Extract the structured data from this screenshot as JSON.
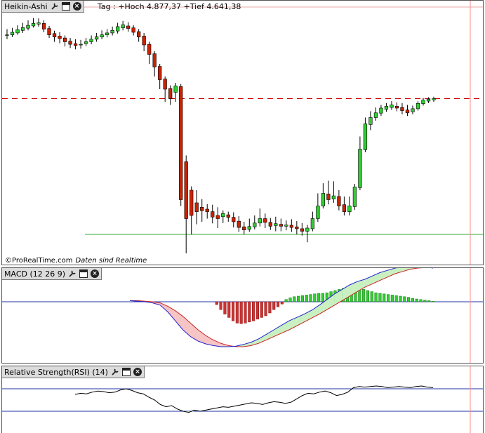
{
  "main": {
    "title": "Heikin-Ashi",
    "info": "Tag : +Hoch 4.877,37 +Tief 4.641,38",
    "copyright": "©ProRealTime.com",
    "realtime": "Daten sind Realtime"
  },
  "macd": {
    "title": "MACD (12 26 9)"
  },
  "rsi": {
    "title": "Relative Strength(RSI) (14)"
  },
  "colors": {
    "up": "#33cc33",
    "down": "#cc2200",
    "wick": "#000000",
    "resistance": "#cc0000",
    "support": "#33aa33",
    "macd_line": "#2222cc",
    "signal_line": "#cc2222",
    "cursor": "#ff8888"
  },
  "chart_data": [
    {
      "type": "candlestick",
      "name": "Heikin-Ashi",
      "ohlc": [
        [
          4820,
          4822,
          4808,
          4840
        ],
        [
          4822,
          4830,
          4815,
          4844
        ],
        [
          4828,
          4838,
          4822,
          4852
        ],
        [
          4836,
          4845,
          4828,
          4860
        ],
        [
          4843,
          4852,
          4836,
          4868
        ],
        [
          4850,
          4858,
          4845,
          4875
        ],
        [
          4856,
          4860,
          4848,
          4874
        ],
        [
          4858,
          4840,
          4830,
          4868
        ],
        [
          4842,
          4822,
          4812,
          4850
        ],
        [
          4826,
          4815,
          4800,
          4835
        ],
        [
          4818,
          4810,
          4795,
          4830
        ],
        [
          4812,
          4800,
          4785,
          4820
        ],
        [
          4802,
          4792,
          4780,
          4812
        ],
        [
          4794,
          4788,
          4776,
          4808
        ],
        [
          4790,
          4792,
          4778,
          4806
        ],
        [
          4794,
          4800,
          4786,
          4812
        ],
        [
          4800,
          4808,
          4792,
          4820
        ],
        [
          4808,
          4816,
          4800,
          4828
        ],
        [
          4815,
          4822,
          4808,
          4836
        ],
        [
          4822,
          4828,
          4814,
          4840
        ],
        [
          4828,
          4836,
          4820,
          4848
        ],
        [
          4834,
          4848,
          4826,
          4860
        ],
        [
          4844,
          4854,
          4836,
          4866
        ],
        [
          4850,
          4842,
          4832,
          4862
        ],
        [
          4844,
          4830,
          4820,
          4852
        ],
        [
          4832,
          4815,
          4800,
          4840
        ],
        [
          4818,
          4790,
          4770,
          4828
        ],
        [
          4792,
          4760,
          4730,
          4800
        ],
        [
          4762,
          4720,
          4690,
          4770
        ],
        [
          4722,
          4680,
          4650,
          4730
        ],
        [
          4682,
          4650,
          4610,
          4690
        ],
        [
          4652,
          4620,
          4600,
          4662
        ],
        [
          4640,
          4660,
          4610,
          4670
        ],
        [
          4658,
          4300,
          4280,
          4666
        ],
        [
          4420,
          4240,
          4130,
          4440
        ],
        [
          4330,
          4250,
          4190,
          4342
        ],
        [
          4290,
          4262,
          4222,
          4330
        ],
        [
          4276,
          4265,
          4230,
          4302
        ],
        [
          4270,
          4262,
          4240,
          4286
        ],
        [
          4262,
          4245,
          4225,
          4284
        ],
        [
          4250,
          4240,
          4210,
          4276
        ],
        [
          4246,
          4256,
          4226,
          4266
        ],
        [
          4252,
          4244,
          4230,
          4262
        ],
        [
          4244,
          4230,
          4212,
          4260
        ],
        [
          4232,
          4212,
          4198,
          4248
        ],
        [
          4214,
          4204,
          4190,
          4230
        ],
        [
          4206,
          4215,
          4198,
          4240
        ],
        [
          4214,
          4226,
          4206,
          4250
        ],
        [
          4226,
          4240,
          4215,
          4272
        ],
        [
          4240,
          4228,
          4210,
          4256
        ],
        [
          4228,
          4216,
          4204,
          4242
        ],
        [
          4218,
          4224,
          4200,
          4246
        ],
        [
          4222,
          4216,
          4200,
          4240
        ],
        [
          4216,
          4220,
          4203,
          4234
        ],
        [
          4219,
          4212,
          4198,
          4238
        ],
        [
          4214,
          4208,
          4190,
          4232
        ],
        [
          4208,
          4200,
          4186,
          4226
        ],
        [
          4200,
          4210,
          4165,
          4220
        ],
        [
          4208,
          4240,
          4200,
          4262
        ],
        [
          4240,
          4280,
          4230,
          4320
        ],
        [
          4280,
          4320,
          4272,
          4352
        ],
        [
          4318,
          4300,
          4285,
          4360
        ],
        [
          4302,
          4312,
          4290,
          4358
        ],
        [
          4310,
          4280,
          4266,
          4330
        ],
        [
          4284,
          4262,
          4250,
          4310
        ],
        [
          4262,
          4280,
          4250,
          4310
        ],
        [
          4278,
          4340,
          4268,
          4350
        ],
        [
          4338,
          4460,
          4330,
          4500
        ],
        [
          4458,
          4540,
          4450,
          4560
        ],
        [
          4538,
          4560,
          4520,
          4580
        ],
        [
          4560,
          4575,
          4550,
          4592
        ],
        [
          4574,
          4590,
          4565,
          4600
        ],
        [
          4586,
          4596,
          4578,
          4606
        ],
        [
          4592,
          4600,
          4584,
          4612
        ],
        [
          4596,
          4590,
          4580,
          4608
        ],
        [
          4592,
          4582,
          4570,
          4606
        ],
        [
          4584,
          4575,
          4565,
          4600
        ],
        [
          4578,
          4588,
          4570,
          4598
        ],
        [
          4588,
          4605,
          4582,
          4612
        ],
        [
          4604,
          4615,
          4598,
          4622
        ],
        [
          4612,
          4618,
          4606,
          4624
        ],
        [
          4616,
          4620,
          4610,
          4626
        ]
      ],
      "ylim": [
        4130,
        4890
      ],
      "resistance_level": 4620,
      "support_level": 4190
    },
    {
      "type": "macd",
      "name": "MACD (12 26 9)",
      "histogram": [
        0,
        0,
        0,
        0,
        0,
        0,
        0,
        0,
        0,
        0,
        0,
        0,
        -5,
        -14,
        -22,
        -28,
        -34,
        -38,
        -39,
        -38,
        -36,
        -34,
        -31,
        -28,
        -25,
        -20,
        -14,
        -9,
        -4,
        4,
        7,
        9,
        10,
        11,
        12,
        13,
        14,
        15,
        15,
        16,
        18,
        20,
        22,
        24,
        26,
        27,
        26,
        24,
        22,
        20,
        18,
        16,
        15,
        14,
        13,
        12,
        11,
        10,
        9,
        8,
        6,
        5,
        4,
        3,
        2,
        1
      ],
      "macd": [
        2,
        1,
        0,
        -2,
        -6,
        -18,
        -34,
        -50,
        -62,
        -70,
        -75,
        -78,
        -80,
        -80,
        -79,
        -76,
        -72,
        -66,
        -58,
        -50,
        -42,
        -34,
        -28,
        -22,
        -15,
        -6,
        4,
        14,
        22,
        30,
        36,
        40,
        46,
        52,
        56,
        60,
        62,
        63,
        64,
        62,
        60
      ],
      "signal": [
        2,
        2,
        1,
        0,
        -2,
        -8,
        -16,
        -26,
        -38,
        -50,
        -60,
        -68,
        -74,
        -78,
        -80,
        -80,
        -78,
        -74,
        -68,
        -62,
        -56,
        -50,
        -43,
        -36,
        -29,
        -22,
        -14,
        -6,
        2,
        10,
        18,
        26,
        32,
        38,
        44,
        50,
        54,
        58,
        60,
        61,
        61
      ],
      "zero_line": 0
    },
    {
      "type": "line",
      "name": "Relative Strength(RSI) (14)",
      "values": [
        60,
        62,
        61,
        64,
        66,
        65,
        63,
        64,
        68,
        70,
        67,
        63,
        61,
        55,
        50,
        42,
        38,
        40,
        34,
        30,
        28,
        32,
        30,
        32,
        34,
        36,
        38,
        37,
        39,
        41,
        43,
        45,
        44,
        42,
        45,
        47,
        46,
        44,
        46,
        52,
        58,
        62,
        61,
        64,
        66,
        63,
        58,
        60,
        64,
        72,
        74,
        73,
        74,
        75,
        74,
        72,
        73,
        74,
        73,
        72,
        74,
        75,
        73,
        72
      ],
      "upper_level": 70,
      "lower_level": 30
    }
  ]
}
